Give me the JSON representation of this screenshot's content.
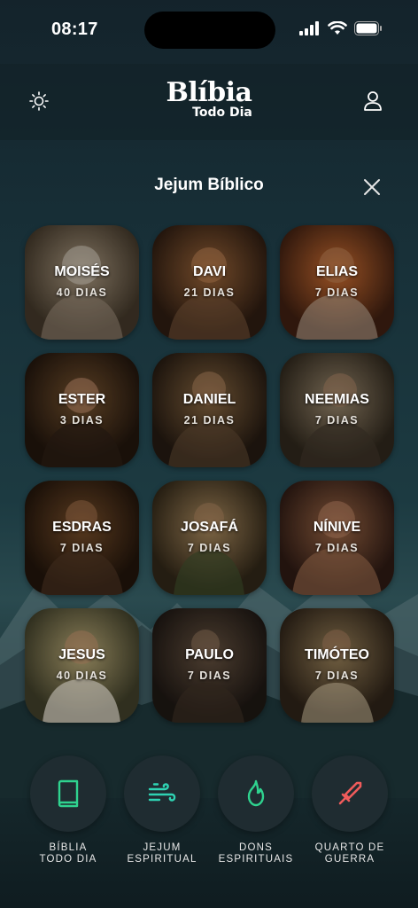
{
  "status_bar": {
    "time": "08:17"
  },
  "header": {
    "logo_title": "Blíbia",
    "logo_subtitle": "Todo Dia",
    "left_icon": "sun-icon",
    "right_icon": "user-icon"
  },
  "section": {
    "title": "Jejum Bíblico",
    "close_icon": "close-icon"
  },
  "fasts": [
    {
      "name": "MOISÉS",
      "days": "40 DIAS"
    },
    {
      "name": "DAVI",
      "days": "21 DIAS"
    },
    {
      "name": "ELIAS",
      "days": "7 DIAS"
    },
    {
      "name": "ESTER",
      "days": "3 DIAS"
    },
    {
      "name": "DANIEL",
      "days": "21 DIAS"
    },
    {
      "name": "NEEMIAS",
      "days": "7 DIAS"
    },
    {
      "name": "ESDRAS",
      "days": "7 DIAS"
    },
    {
      "name": "JOSAFÁ",
      "days": "7 DIAS"
    },
    {
      "name": "NÍNIVE",
      "days": "7 DIAS"
    },
    {
      "name": "JESUS",
      "days": "40 DIAS"
    },
    {
      "name": "PAULO",
      "days": "7 DIAS"
    },
    {
      "name": "TIMÓTEO",
      "days": "7 DIAS"
    }
  ],
  "bottom_nav": [
    {
      "label": "BÍBLIA\nTODO DIA",
      "icon": "book-icon",
      "color": "#2fd38f"
    },
    {
      "label": "JEJUM\nESPIRITUAL",
      "icon": "wind-icon",
      "color": "#2fd3b3"
    },
    {
      "label": "DONS\nESPIRITUAIS",
      "icon": "flame-icon",
      "color": "#2fd38f"
    },
    {
      "label": "QUARTO DE\nGUERRA",
      "icon": "sword-icon",
      "color": "#ef5b5b"
    }
  ]
}
